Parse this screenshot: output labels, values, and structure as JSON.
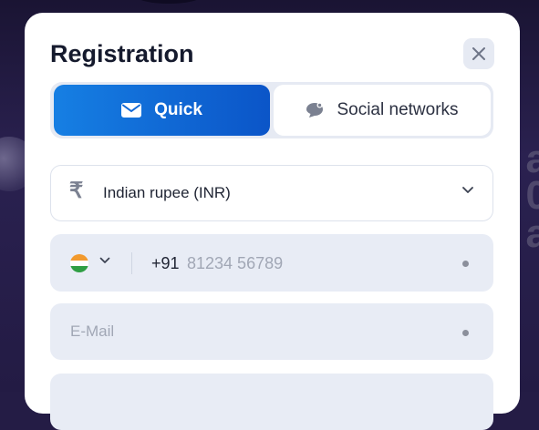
{
  "modal": {
    "title": "Registration",
    "close_icon": "close-icon"
  },
  "tabs": [
    {
      "label": "Quick",
      "icon": "envelope-icon",
      "active": true
    },
    {
      "label": "Social networks",
      "icon": "chat-bubble-icon",
      "active": false
    }
  ],
  "currency": {
    "icon": "rupee-icon",
    "symbol": "₹",
    "selected": "Indian rupee (INR)"
  },
  "phone": {
    "country_flag": "india-flag-icon",
    "code": "+91",
    "placeholder": "81234 56789"
  },
  "email": {
    "placeholder": "E-Mail"
  },
  "colors": {
    "accent": "#0b6fdc",
    "backdrop": "#241c45",
    "field_bg": "#e8ecf5",
    "title": "#151a2d"
  }
}
